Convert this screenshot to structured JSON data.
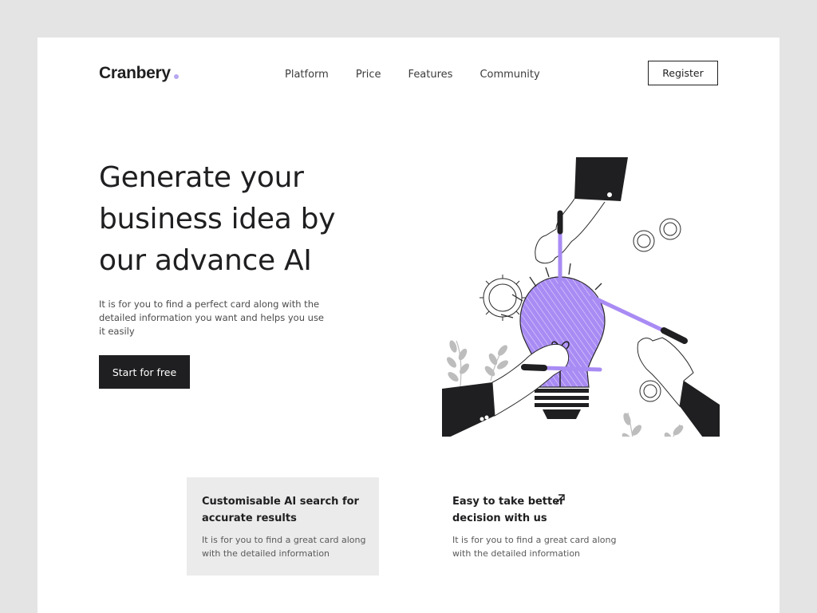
{
  "header": {
    "logo": "Cranbery",
    "nav": [
      "Platform",
      "Price",
      "Features",
      "Community"
    ],
    "register_label": "Register"
  },
  "hero": {
    "title": "Generate your business idea by our advance AI",
    "description": "It is for you to find a perfect card along with the detailed information you want and helps you use it easily",
    "cta_label": "Start for free",
    "illustration": "lightbulb-idea-hands-illustration"
  },
  "features": [
    {
      "title": "Customisable AI search for accurate results",
      "description": "It is for you to find a great card along with the detailed information",
      "highlighted": true
    },
    {
      "title": "Easy to take better decision with us",
      "description": "It is for you to find a great card along with the detailed information",
      "icon": "arrow-up-right-icon"
    }
  ],
  "colors": {
    "background": "#e4e4e4",
    "card": "#ffffff",
    "text": "#1f1f21",
    "accent": "#a98bf4",
    "logo_dot": "#b7a7f0",
    "feature_highlight": "#ebebeb",
    "plant": "#bdbdbd"
  }
}
